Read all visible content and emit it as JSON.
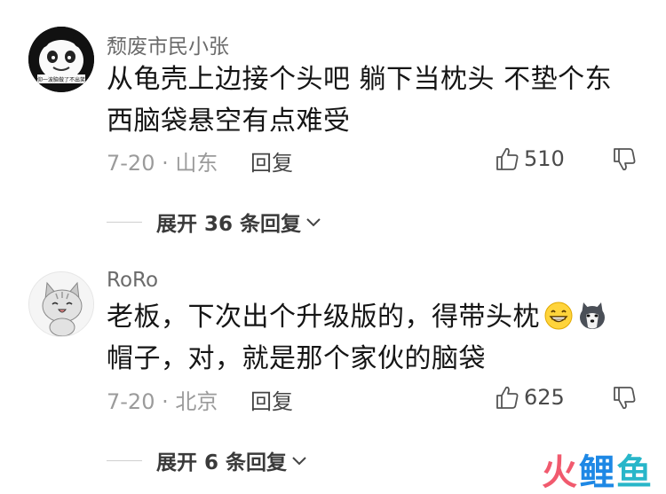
{
  "comments": [
    {
      "username": "颓废市民小张",
      "avatar_caption": "仰一波脑做了不出笑",
      "text_lines": [
        "从龟壳上边接个头吧  躺下当枕头  不垫个东",
        "西脑袋悬空有点难受"
      ],
      "date_location": "7-20 · 山东",
      "reply_label": "回复",
      "like_count": "510",
      "expand_label": "展开 36 条回复"
    },
    {
      "username": "RoRo",
      "text_lines": [
        "老板，下次出个升级版的，得带头枕",
        "帽子，对，就是那个家伙的脑袋"
      ],
      "emojis": [
        "grinning-face-emoji",
        "husky-dog-emoji"
      ],
      "date_location": "7-20 · 北京",
      "reply_label": "回复",
      "like_count": "625",
      "expand_label": "展开 6 条回复"
    }
  ],
  "watermark": {
    "part1": "火",
    "part2": "鲤",
    "part3": "鱼"
  },
  "colors": {
    "username": "#6b6b6b",
    "meta": "#9b9b9b",
    "watermark_red": "#f15a6e",
    "watermark_blue": "#1e88e5",
    "watermark_teal": "#28b6c9"
  }
}
